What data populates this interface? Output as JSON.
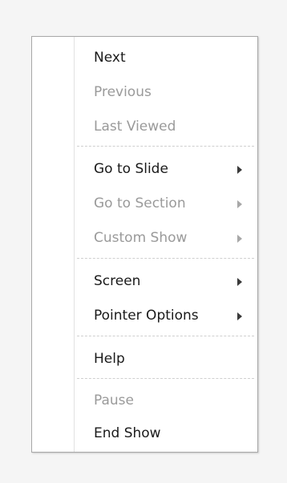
{
  "menu": {
    "items": {
      "next": {
        "label": "Next"
      },
      "previous": {
        "label": "Previous"
      },
      "last_viewed": {
        "label": "Last Viewed"
      },
      "go_to_slide": {
        "label": "Go to Slide"
      },
      "go_to_section": {
        "label": "Go to Section"
      },
      "custom_show": {
        "label": "Custom Show"
      },
      "screen": {
        "label": "Screen"
      },
      "pointer_options": {
        "label": "Pointer Options"
      },
      "help": {
        "label": "Help"
      },
      "pause": {
        "label": "Pause"
      },
      "end_show": {
        "label": "End Show"
      }
    },
    "icons": {
      "submenu_arrow": "submenu-arrow-icon"
    },
    "colors": {
      "enabled_text": "#1a1a1a",
      "disabled_text": "#9a9a9a",
      "border": "#a8a8a8",
      "separator": "#cfcfcf"
    }
  }
}
